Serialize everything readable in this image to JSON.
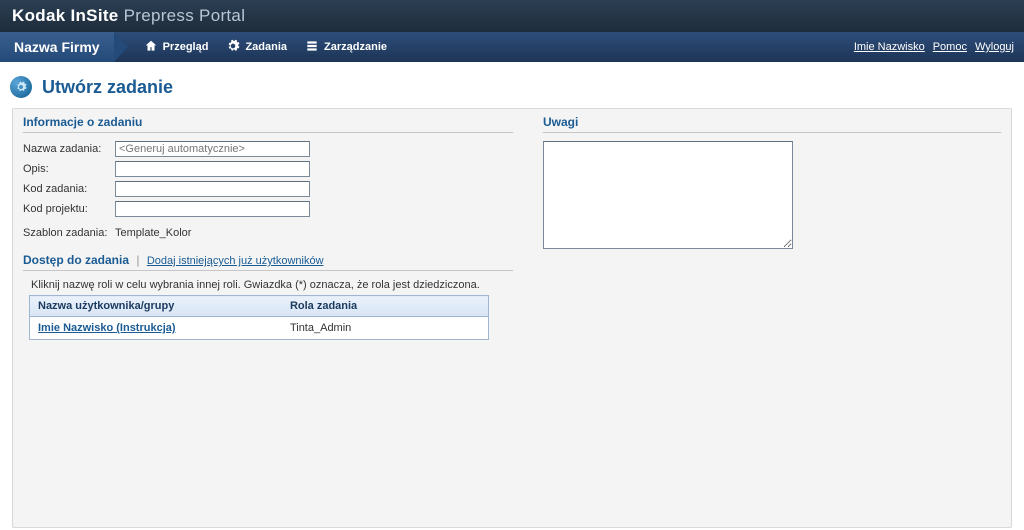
{
  "brand": {
    "part1": "Kodak InSite",
    "part2": "Prepress Portal"
  },
  "company": "Nazwa Firmy",
  "nav": {
    "overview": "Przegląd",
    "jobs": "Zadania",
    "admin": "Zarządzanie"
  },
  "userlinks": {
    "username": "Imie Nazwisko",
    "help": "Pomoc",
    "logout": "Wyloguj"
  },
  "page": {
    "title": "Utwórz zadanie"
  },
  "sections": {
    "info": "Informacje o zadaniu",
    "notes": "Uwagi",
    "access": "Dostęp do zadania",
    "access_link": "Dodaj istniejących już użytkowników",
    "access_hint": "Kliknij nazwę roli w celu wybrania innej roli. Gwiazdka (*) oznacza, że rola jest dziedziczona."
  },
  "fields": {
    "job_name_label": "Nazwa zadania:",
    "job_name_placeholder": "<Generuj automatycznie>",
    "desc_label": "Opis:",
    "desc_value": "",
    "job_code_label": "Kod zadania:",
    "job_code_value": "",
    "proj_code_label": "Kod projektu:",
    "proj_code_value": "",
    "template_label": "Szablon zadania:",
    "template_value": "Template_Kolor"
  },
  "access_table": {
    "col_user": "Nazwa użytkownika/grupy",
    "col_role": "Rola zadania",
    "rows": [
      {
        "user": "Imie Nazwisko (Instrukcja)",
        "role": "Tinta_Admin"
      }
    ]
  },
  "notes_value": "",
  "colors": {
    "accent": "#1a5b93"
  }
}
